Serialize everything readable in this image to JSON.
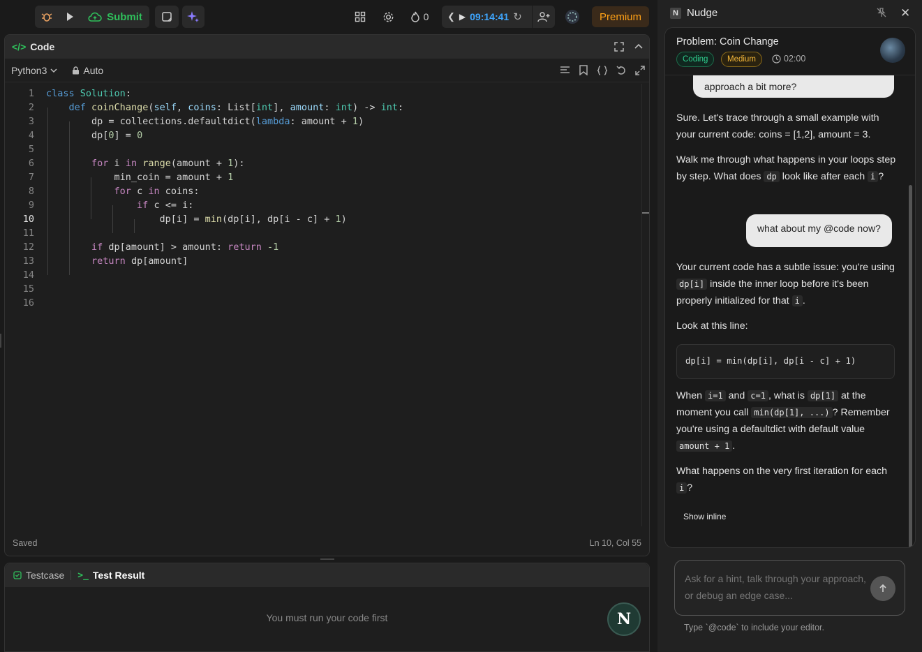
{
  "topbar": {
    "submit_label": "Submit",
    "streak_count": "0",
    "timer": "09:14:41",
    "premium_label": "Premium"
  },
  "code_panel": {
    "title": "Code",
    "language": "Python3",
    "mode": "Auto",
    "status_left": "Saved",
    "status_right": "Ln 10, Col 55",
    "current_line": 10,
    "line_numbers": [
      "1",
      "2",
      "3",
      "4",
      "5",
      "6",
      "7",
      "8",
      "9",
      "10",
      "11",
      "12",
      "13",
      "14",
      "15",
      "16"
    ]
  },
  "test_panel": {
    "tab_testcase": "Testcase",
    "tab_result": "Test Result",
    "message": "You must run your code first",
    "n_button": "N"
  },
  "nudge": {
    "title": "Nudge",
    "logo_letter": "N",
    "problem_title": "Problem: Coin Change",
    "tag_coding": "Coding",
    "tag_medium": "Medium",
    "time": "02:00",
    "msg_user_1": "approach a bit more?",
    "ai_1_p1": "Sure. Let's trace through a small example with your current code: coins = [1,2], amount = 3.",
    "ai_1_p2_a": "Walk me through what happens in your loops step by step. What does ",
    "ai_1_p2_code1": "dp",
    "ai_1_p2_b": " look like after each ",
    "ai_1_p2_code2": "i",
    "ai_1_p2_c": "?",
    "msg_user_2": "what about my @code now?",
    "ai_2_p1_a": "Your current code has a subtle issue: you're using ",
    "ai_2_p1_code1": "dp[i]",
    "ai_2_p1_b": " inside the inner loop before it's been properly initialized for that ",
    "ai_2_p1_code2": "i",
    "ai_2_p1_c": ".",
    "ai_2_p2": "Look at this line:",
    "code_snippet": "dp[i] = min(dp[i], dp[i - c] + 1)",
    "ai_2_p3_a": "When ",
    "ai_2_p3_code1": "i=1",
    "ai_2_p3_b": " and ",
    "ai_2_p3_code2": "c=1",
    "ai_2_p3_c": ", what is ",
    "ai_2_p3_code3": "dp[1]",
    "ai_2_p3_d": " at the moment you call ",
    "ai_2_p3_code4": "min(dp[1], ...)",
    "ai_2_p3_e": "? Remember you're using a defaultdict with default value ",
    "ai_2_p3_code5": "amount + 1",
    "ai_2_p3_f": ".",
    "ai_2_p4_a": "What happens on the very first iteration for each ",
    "ai_2_p4_code": "i",
    "ai_2_p4_b": "?",
    "show_inline": "Show inline",
    "input_placeholder": "Ask for a hint, talk through your approach, or debug an edge case...",
    "input_hint": "Type `@code` to include your editor."
  },
  "colors": {
    "accent_green": "#2fbf5b",
    "timer_blue": "#3ea6ff",
    "premium_orange": "#ffa116"
  }
}
